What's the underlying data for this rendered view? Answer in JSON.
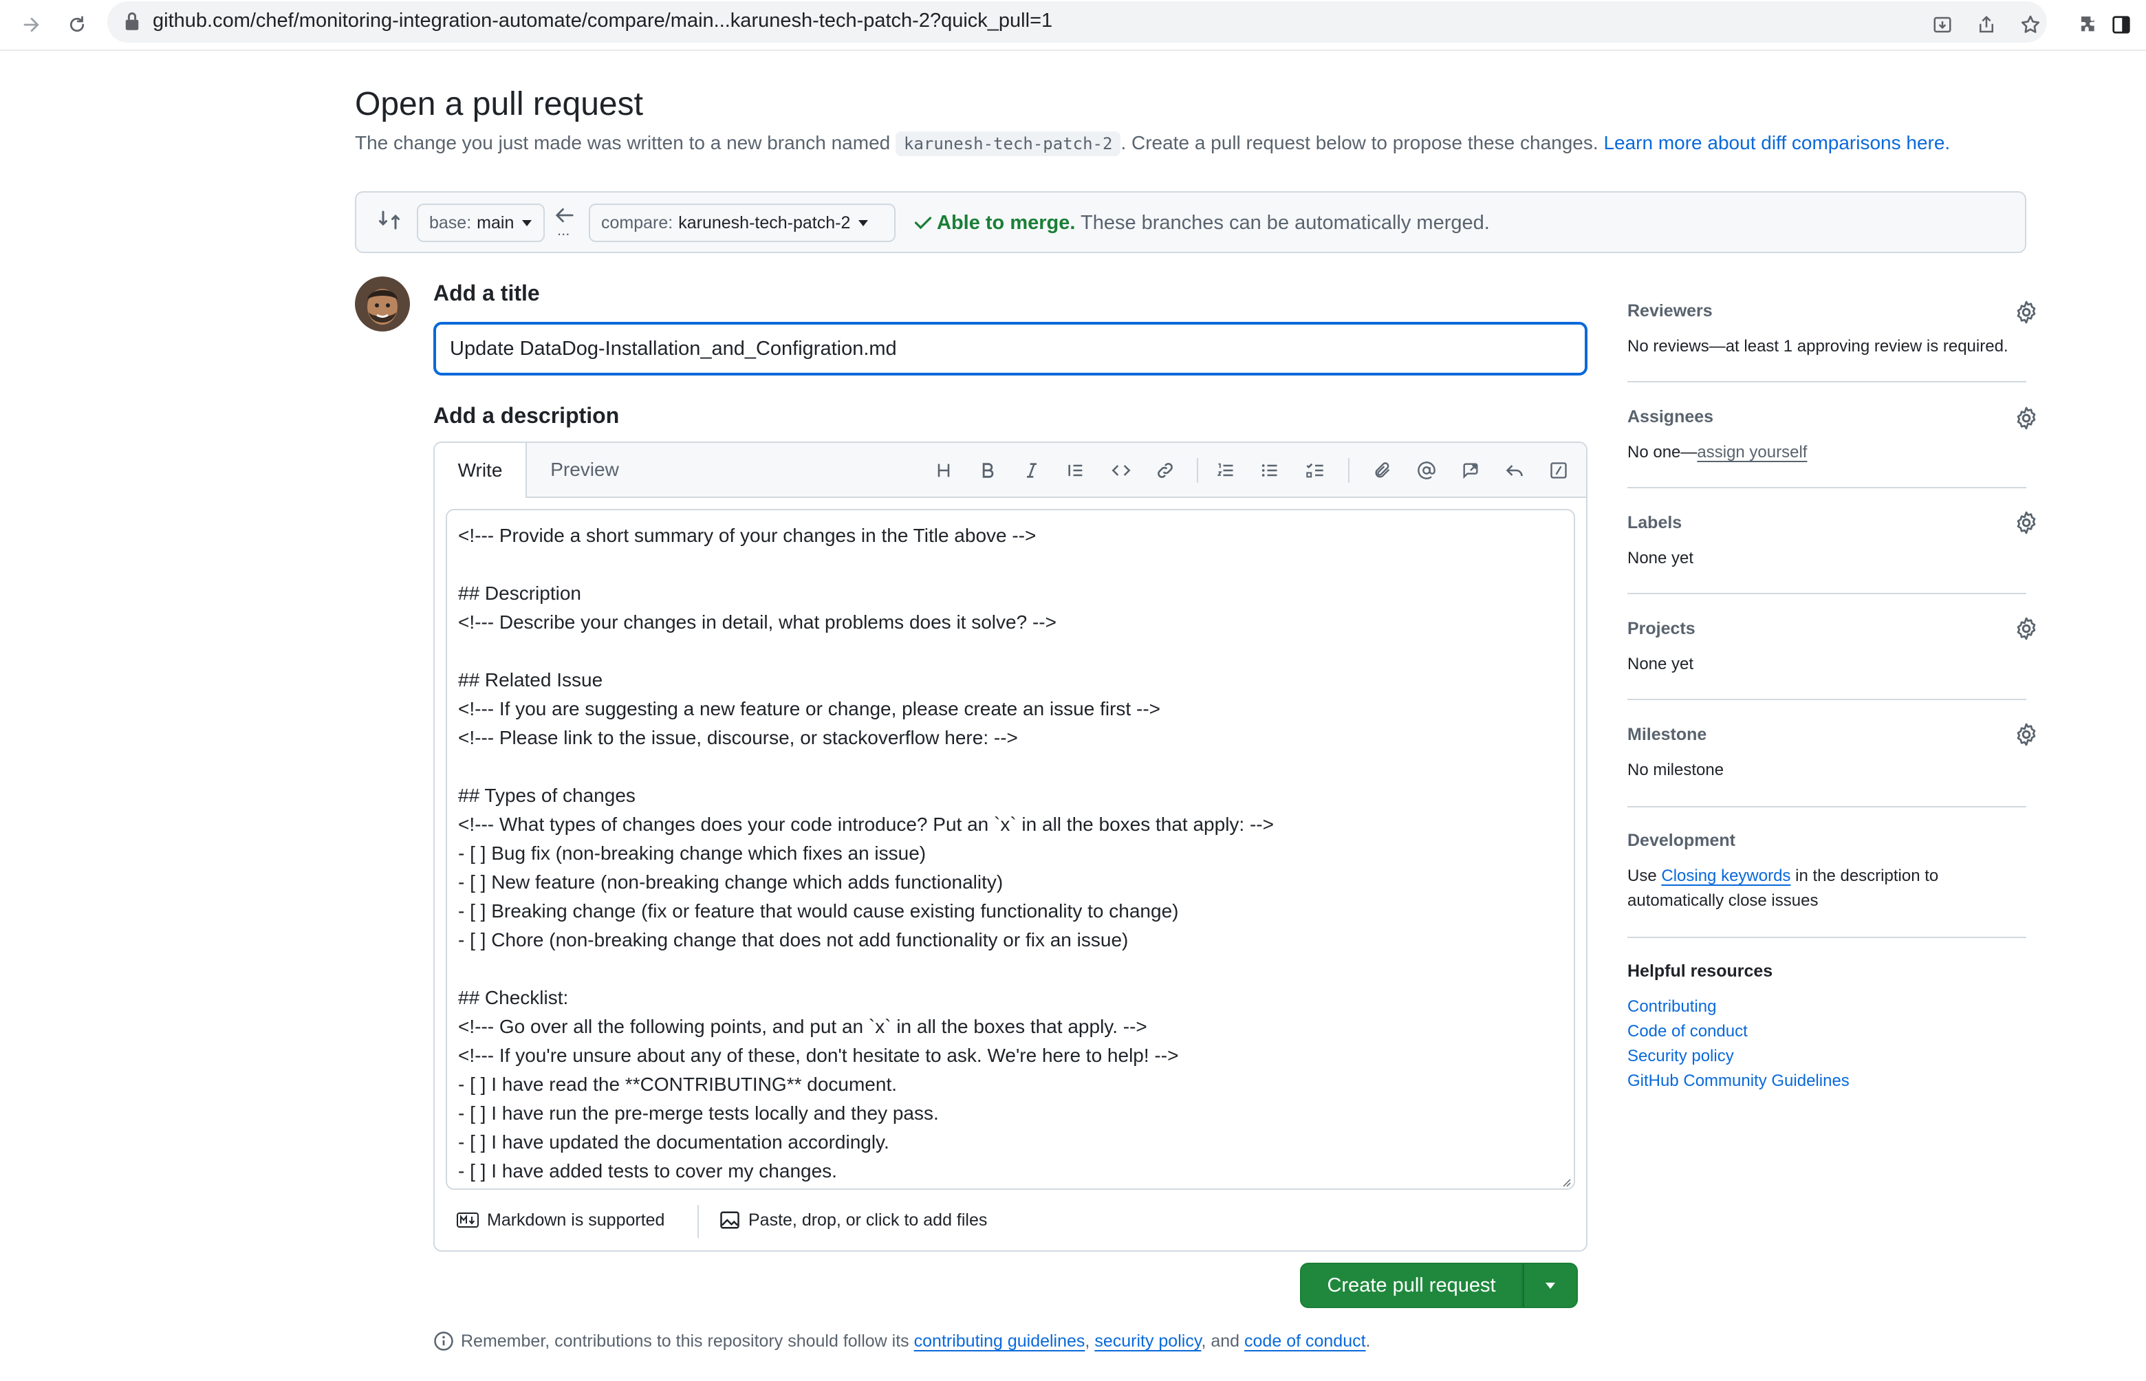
{
  "browser": {
    "url": "github.com/chef/monitoring-integration-automate/compare/main...karunesh-tech-patch-2?quick_pull=1"
  },
  "header": {
    "title": "Open a pull request",
    "subtitle_before": "The change you just made was written to a new branch named",
    "branch_name": "karunesh-tech-patch-2",
    "subtitle_after": ". Create a pull request below to propose these changes.",
    "learn_more_link": "Learn more about diff comparisons here."
  },
  "compare": {
    "base_prefix": "base:",
    "base_branch": "main",
    "compare_prefix": "compare:",
    "compare_branch": "karunesh-tech-patch-2",
    "dots": "...",
    "merge_ok": "Able to merge.",
    "merge_note": "These branches can be automatically merged."
  },
  "form": {
    "title_label": "Add a title",
    "title_value": "Update DataDog-Installation_and_Configration.md",
    "description_label": "Add a description",
    "tabs": [
      "Write",
      "Preview"
    ],
    "body": "<!--- Provide a short summary of your changes in the Title above -->\n\n## Description\n<!--- Describe your changes in detail, what problems does it solve? -->\n\n## Related Issue\n<!--- If you are suggesting a new feature or change, please create an issue first -->\n<!--- Please link to the issue, discourse, or stackoverflow here: -->\n\n## Types of changes\n<!--- What types of changes does your code introduce? Put an `x` in all the boxes that apply: -->\n- [ ] Bug fix (non-breaking change which fixes an issue)\n- [ ] New feature (non-breaking change which adds functionality)\n- [ ] Breaking change (fix or feature that would cause existing functionality to change)\n- [ ] Chore (non-breaking change that does not add functionality or fix an issue)\n\n## Checklist:\n<!--- Go over all the following points, and put an `x` in all the boxes that apply. -->\n<!--- If you're unsure about any of these, don't hesitate to ask. We're here to help! -->\n- [ ] I have read the **CONTRIBUTING** document.\n- [ ] I have run the pre-merge tests locally and they pass.\n- [ ] I have updated the documentation accordingly.\n- [ ] I have added tests to cover my changes.",
    "markdown_note": "Markdown is supported",
    "attach_note": "Paste, drop, or click to add files",
    "submit_label": "Create pull request"
  },
  "footer_note": {
    "before": "Remember, contributions to this repository should follow its",
    "link1": "contributing guidelines",
    "sep1": ",",
    "link2": "security policy",
    "sep2": ", and",
    "link3": "code of conduct",
    "end": "."
  },
  "sidebar": {
    "reviewers": {
      "label": "Reviewers",
      "value": "No reviews—at least 1 approving review is required."
    },
    "assignees": {
      "label": "Assignees",
      "value_prefix": "No one—",
      "value_link": "assign yourself"
    },
    "labels": {
      "label": "Labels",
      "value": "None yet"
    },
    "projects": {
      "label": "Projects",
      "value": "None yet"
    },
    "milestone": {
      "label": "Milestone",
      "value": "No milestone"
    },
    "development": {
      "label": "Development",
      "text_before": "Use",
      "link": "Closing keywords",
      "text_after": "in the description to",
      "text_line2": "automatically close issues"
    },
    "resources": {
      "label": "Helpful resources",
      "links": [
        "Contributing",
        "Code of conduct",
        "Security policy",
        "GitHub Community Guidelines"
      ]
    }
  }
}
